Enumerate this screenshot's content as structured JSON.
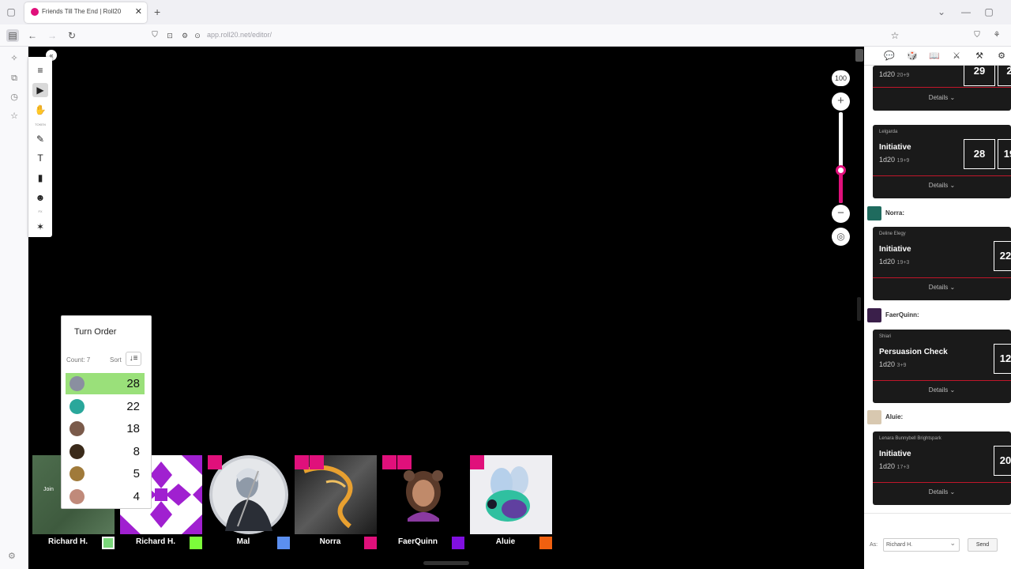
{
  "browser": {
    "tab_title": "Friends Till The End | Roll20",
    "tab_close": "✕",
    "new_tab": "+",
    "url": "app.roll20.net/editor/"
  },
  "icons": {
    "back": "←",
    "forward": "→",
    "reload": "↻",
    "shield": "⛉",
    "lock": "🔒",
    "bookmark": "☆",
    "list_all": "⌄",
    "tools_menu": "≡",
    "select": "▶",
    "pan": "✋",
    "brush": "✎",
    "text": "T",
    "fog": "▮",
    "mask": "☻",
    "magic": "✶",
    "collapse": "«",
    "gear": "⚙",
    "sort": "↓≡"
  },
  "toolbar": {
    "caption_1": "TOKEN",
    "caption_2": "FX"
  },
  "zoom": {
    "level": "100",
    "plus": "+",
    "minus": "−",
    "fit": "◎",
    "fraction": 0.36
  },
  "turn_order": {
    "title": "Turn Order",
    "count_label": "Count: 7",
    "sort_label": "Sort",
    "rows": [
      {
        "value": "28",
        "color": "#8a8fa0",
        "active": true
      },
      {
        "value": "22",
        "color": "#2aa79b",
        "active": false
      },
      {
        "value": "18",
        "color": "#7a5a4a",
        "active": false
      },
      {
        "value": "8",
        "color": "#3a2a1a",
        "active": false
      },
      {
        "value": "5",
        "color": "#a07a3a",
        "active": false
      },
      {
        "value": "4",
        "color": "#c08a7a",
        "active": false
      }
    ]
  },
  "players": [
    {
      "name": "Richard H.",
      "color": "#7ad67a",
      "extra": "Join"
    },
    {
      "name": "Richard H.",
      "color": "#7cfc3a"
    },
    {
      "name": "Mal",
      "color": "#5b8ff0"
    },
    {
      "name": "Norra",
      "color": "#e0107b"
    },
    {
      "name": "FaerQuinn",
      "color": "#8010e0"
    },
    {
      "name": "Aluie",
      "color": "#f06010"
    }
  ],
  "chat": {
    "tabs": [
      "💬",
      "🎲",
      "📖",
      "⚔",
      "⚒",
      "⚙"
    ],
    "cards": [
      {
        "character": "",
        "name": "",
        "formula": "1d20",
        "formula_sub": "20+9",
        "result": "29",
        "result2": "2",
        "details": "Details ⌄"
      },
      {
        "character": "Lelgarda",
        "name": "Initiative",
        "formula": "1d20",
        "formula_sub": "19+9",
        "result": "28",
        "result2": "19",
        "details": "Details ⌄"
      },
      {
        "character": "Deline Elegy",
        "name": "Initiative",
        "formula": "1d20",
        "formula_sub": "19+3",
        "result": "22",
        "details": "Details ⌄"
      },
      {
        "character": "Shiari",
        "name": "Persuasion Check",
        "formula": "1d20",
        "formula_sub": "3+9",
        "result": "12",
        "details": "Details ⌄"
      },
      {
        "character": "Lenara Bunnybell Brightspark",
        "name": "Initiative",
        "formula": "1d20",
        "formula_sub": "17+3",
        "result": "20",
        "details": "Details ⌄"
      }
    ],
    "speakers": [
      {
        "name": "Norra:",
        "color": "#1f6b5e"
      },
      {
        "name": "FaerQuinn:",
        "color": "#3a1f4a"
      },
      {
        "name": "Aluie:",
        "color": "#d8c8b0"
      }
    ],
    "as_label": "As:",
    "as_value": "Richard H.",
    "send_label": "Send"
  },
  "colors": {
    "accent": "#e0107b",
    "active_row": "#9ae07a",
    "card_bg": "#1a1a1a",
    "card_line": "#c0162a"
  }
}
